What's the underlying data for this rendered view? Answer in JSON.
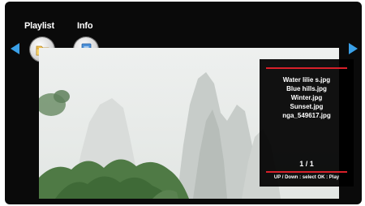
{
  "tabs": [
    {
      "label": "Playlist",
      "icon": "folder-icon"
    },
    {
      "label": "Info",
      "icon": "document-icon"
    }
  ],
  "nav": {
    "prev_icon": "arrow-left-icon",
    "next_icon": "arrow-right-icon"
  },
  "playlist": {
    "files": [
      "Water lilie s.jpg",
      "Blue hills.jpg",
      "Winter.jpg",
      "Sunset.jpg",
      "nga_549617.jpg"
    ],
    "page": "1 / 1",
    "help": "UP / Down : select   OK : Play"
  },
  "colors": {
    "accent": "#3aa0e8",
    "divider": "#d8202a",
    "panel_bg": "#000000"
  }
}
